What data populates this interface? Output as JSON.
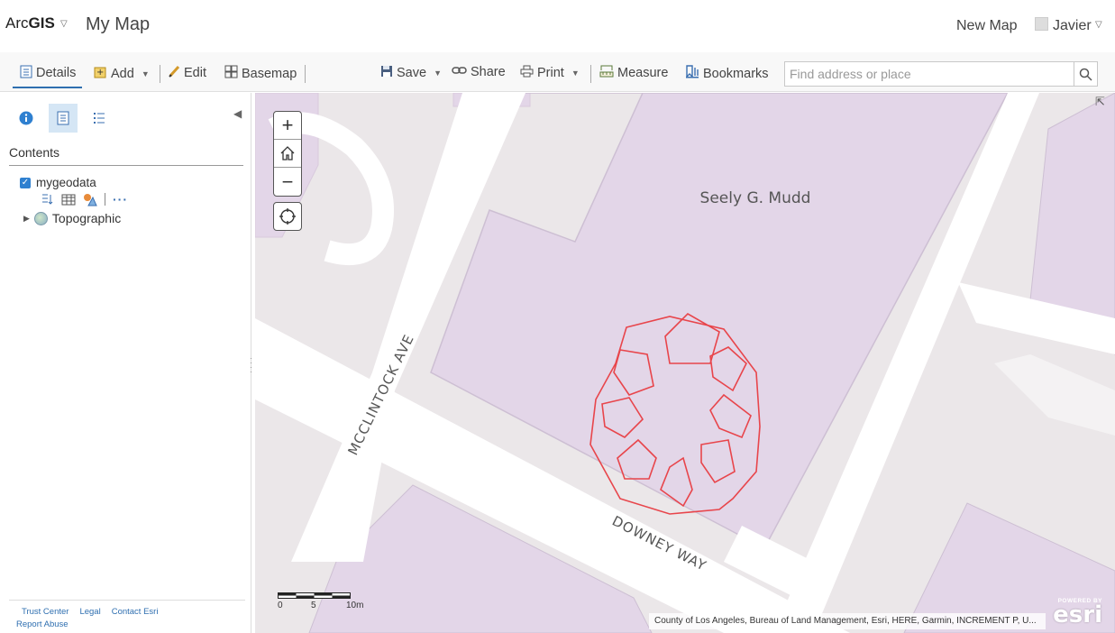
{
  "header": {
    "brand_prefix": "Arc",
    "brand_bold": "GIS",
    "map_title": "My Map",
    "new_map": "New Map",
    "user_name": "Javier"
  },
  "toolbar": {
    "details": "Details",
    "add": "Add",
    "edit": "Edit",
    "basemap": "Basemap",
    "save": "Save",
    "share": "Share",
    "print": "Print",
    "measure": "Measure",
    "bookmarks": "Bookmarks",
    "search_placeholder": "Find address or place"
  },
  "panel": {
    "contents_title": "Contents",
    "layers": [
      {
        "name": "mygeodata",
        "checked": true
      },
      {
        "name": "Topographic"
      }
    ],
    "footer_links": [
      "Trust Center",
      "Legal",
      "Contact Esri",
      "Report Abuse"
    ]
  },
  "map": {
    "labels": {
      "building": "Seely G. Mudd",
      "street1": "MCCLINTOCK AVE",
      "street2": "DOWNEY WAY"
    },
    "scale": {
      "labels": [
        "0",
        "5",
        "10m"
      ]
    },
    "attribution": "County of Los Angeles, Bureau of Land Management, Esri, HERE, Garmin, INCREMENT P, U...",
    "esri_powered": "POWERED BY",
    "esri_logo": "esri",
    "colors": {
      "building": "#e3d6e8",
      "street": "#ffffff",
      "ground": "#ebe7e9",
      "feature": "#e8454b"
    }
  }
}
